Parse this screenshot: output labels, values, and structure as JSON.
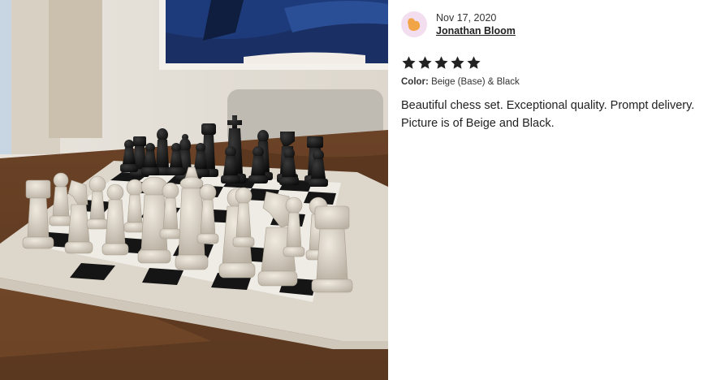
{
  "review": {
    "date": "Nov 17, 2020",
    "author": "Jonathan Bloom",
    "rating": 5,
    "rating_max": 5,
    "variation_label": "Color:",
    "variation_value": "Beige (Base) & Black",
    "text": "Beautiful chess set. Exceptional quality. Prompt delivery. Picture is of Beige and Black."
  },
  "icons": {
    "avatar": "avatar-blob-icon",
    "star": "star-icon"
  },
  "colors": {
    "star": "#222222",
    "avatar_bg": "#f3def0",
    "avatar_fg": "#f1a546"
  }
}
